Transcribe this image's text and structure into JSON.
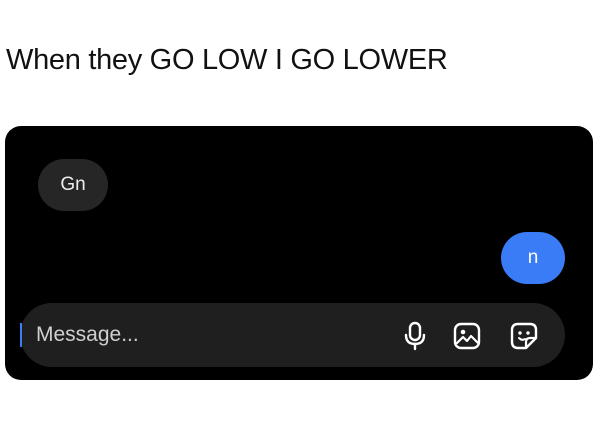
{
  "caption": "When they GO LOW I GO LOWER",
  "chat": {
    "received_message": "Gn",
    "sent_message": "n"
  },
  "composer": {
    "placeholder": "Message..."
  },
  "icons": {
    "mic": "microphone-icon",
    "gallery": "gallery-icon",
    "sticker": "sticker-icon"
  },
  "colors": {
    "background": "#000000",
    "received_bubble": "#262626",
    "sent_bubble": "#3a7bf6",
    "composer": "#1f1f1f"
  }
}
